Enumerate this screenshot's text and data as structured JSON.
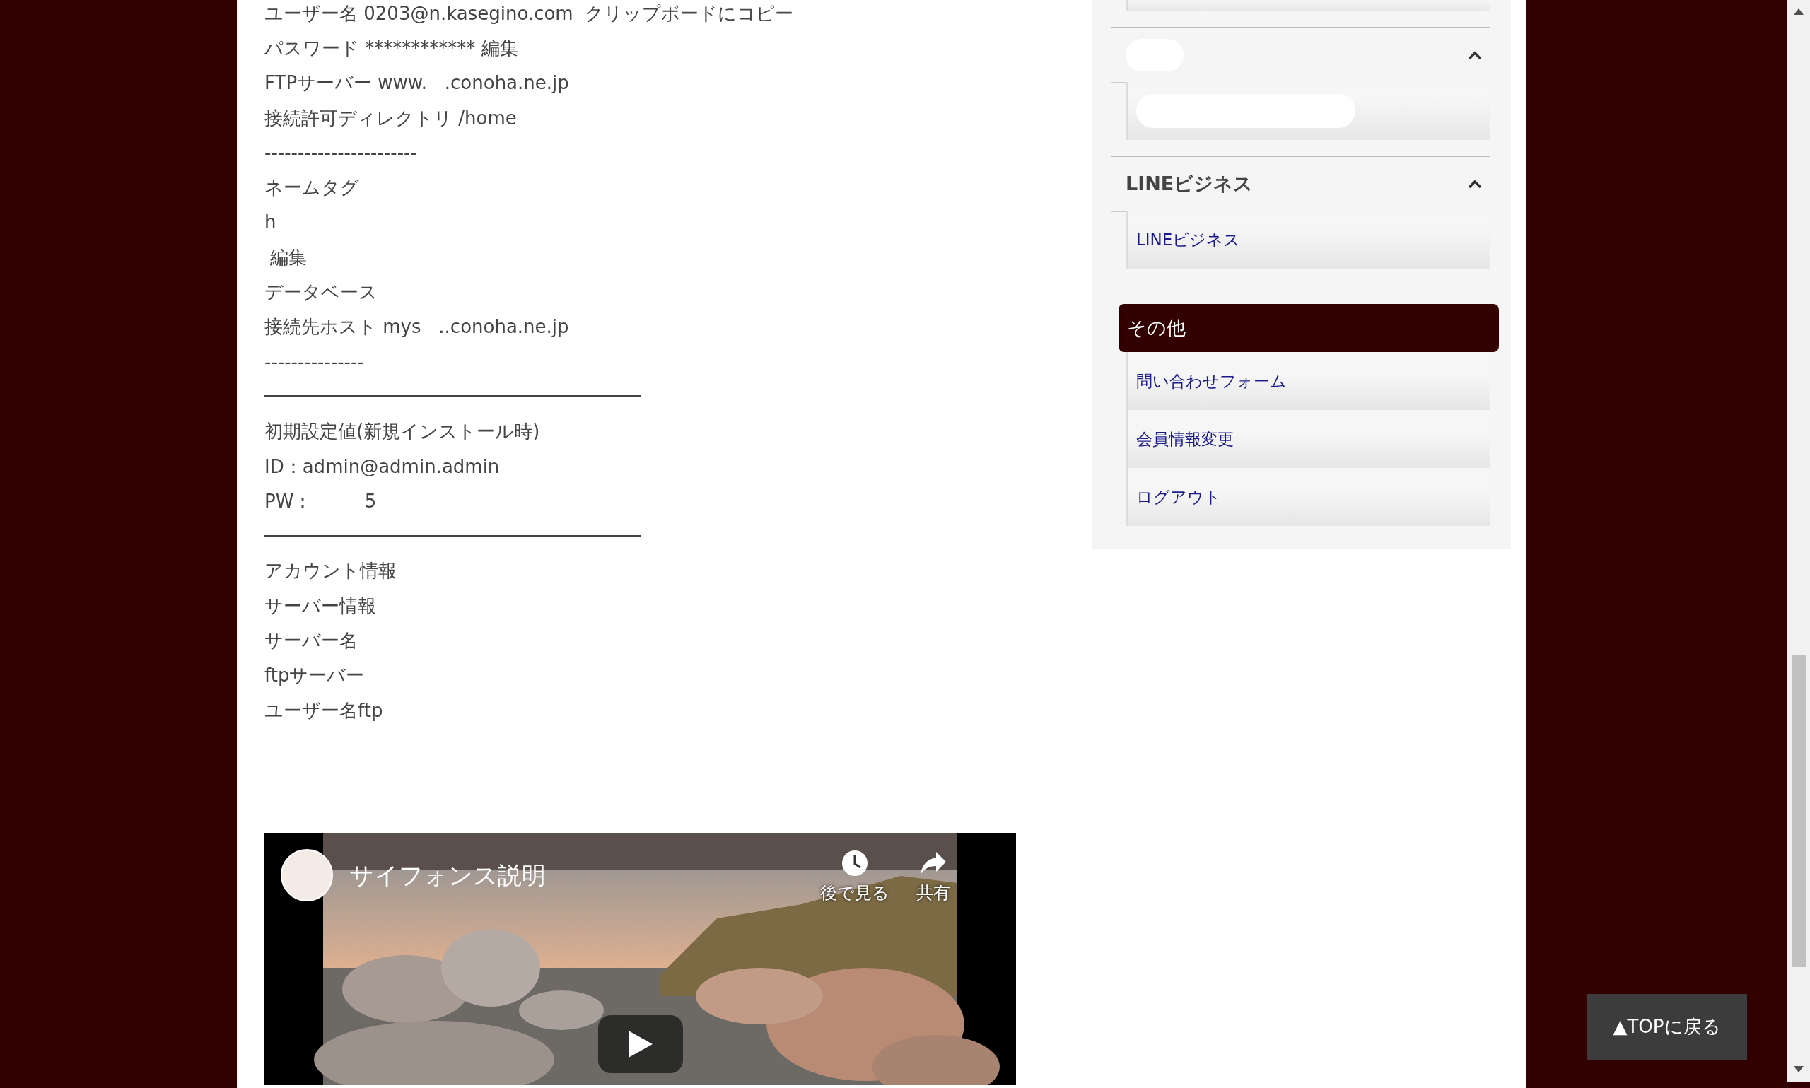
{
  "main": {
    "lines": [
      {
        "kind": "text",
        "text": "ユーザー名 0203@n.kasegino.com  クリップボードにコピー"
      },
      {
        "kind": "text",
        "text": "パスワード ************ 編集"
      },
      {
        "kind": "text",
        "text": "FTPサーバー www.   .conoha.ne.jp"
      },
      {
        "kind": "text",
        "text": "接続許可ディレクトリ /home"
      },
      {
        "kind": "text",
        "text": "-----------------------"
      },
      {
        "kind": "text",
        "text": "ネームタグ"
      },
      {
        "kind": "text",
        "text": "h"
      },
      {
        "kind": "text",
        "text": " 編集"
      },
      {
        "kind": "text",
        "text": "データベース"
      },
      {
        "kind": "text",
        "text": "接続先ホスト mys   ..conoha.ne.jp"
      },
      {
        "kind": "text",
        "text": "---------------"
      },
      {
        "kind": "rule"
      },
      {
        "kind": "text",
        "text": "初期設定値(新規インストール時)"
      },
      {
        "kind": "text",
        "text": "ID：admin@admin.admin"
      },
      {
        "kind": "text",
        "text": "PW：         5"
      },
      {
        "kind": "rule"
      },
      {
        "kind": "text",
        "text": "アカウント情報"
      },
      {
        "kind": "text",
        "text": "サーバー情報"
      },
      {
        "kind": "text",
        "text": "サーバー名"
      },
      {
        "kind": "text",
        "text": "ftpサーバー"
      },
      {
        "kind": "text",
        "text": "ユーザー名ftp"
      }
    ]
  },
  "video": {
    "title": "サイフォンス説明",
    "actions": [
      {
        "kind": "watch-later",
        "label": "後で見る"
      },
      {
        "kind": "share",
        "label": "共有"
      }
    ]
  },
  "sidebar": {
    "sections": [
      {
        "kind": "redacted",
        "expanded": true,
        "items": [
          {
            "kind": "redacted"
          }
        ]
      },
      {
        "kind": "titled",
        "title": "LINEビジネス",
        "expanded": true,
        "items": [
          {
            "kind": "link",
            "label": "LINEビジネス"
          }
        ]
      }
    ],
    "menu": {
      "title": "その他",
      "items": [
        {
          "label": "問い合わせフォーム"
        },
        {
          "label": "会員情報変更"
        },
        {
          "label": "ログアウト"
        }
      ]
    }
  },
  "top_button": {
    "label": "▲TOPに戻る"
  }
}
